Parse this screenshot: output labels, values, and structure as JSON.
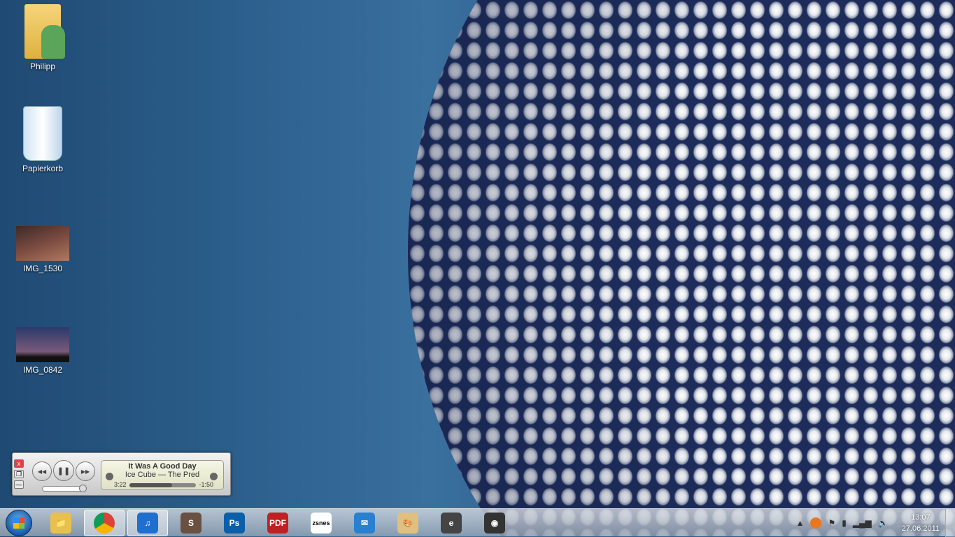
{
  "desktop": {
    "icons": [
      {
        "label": "Philipp"
      },
      {
        "label": "Papierkorb"
      },
      {
        "label": "IMG_1530"
      },
      {
        "label": "IMG_0842"
      }
    ]
  },
  "player": {
    "title": "It Was A Good Day",
    "artist_album": "Ice Cube — The Pred",
    "elapsed": "3:22",
    "remaining": "-1:50",
    "progress": 0.64,
    "volume": 0.95,
    "window_buttons": {
      "close": "x",
      "restore": "❐",
      "minimize": "—"
    },
    "prev": "◀◀",
    "pause": "❚❚",
    "next": "▶▶"
  },
  "taskbar": {
    "apps": [
      {
        "name": "explorer",
        "label": "📁"
      },
      {
        "name": "chrome",
        "label": ""
      },
      {
        "name": "itunes",
        "label": "♫"
      },
      {
        "name": "app-s",
        "label": "S"
      },
      {
        "name": "photoshop",
        "label": "Ps"
      },
      {
        "name": "pdf",
        "label": "PDF"
      },
      {
        "name": "zsnes",
        "label": "zsnes"
      },
      {
        "name": "thunderbird-like",
        "label": "✉"
      },
      {
        "name": "paint",
        "label": "🎨"
      },
      {
        "name": "app-e",
        "label": "e"
      },
      {
        "name": "camera",
        "label": "◉"
      }
    ]
  },
  "tray": {
    "time": "13:07",
    "date": "27.06.2011",
    "icons": [
      "show-hidden-icon",
      "avast-icon",
      "action-center-flag-icon",
      "power-icon",
      "network-icon",
      "volume-icon"
    ]
  }
}
